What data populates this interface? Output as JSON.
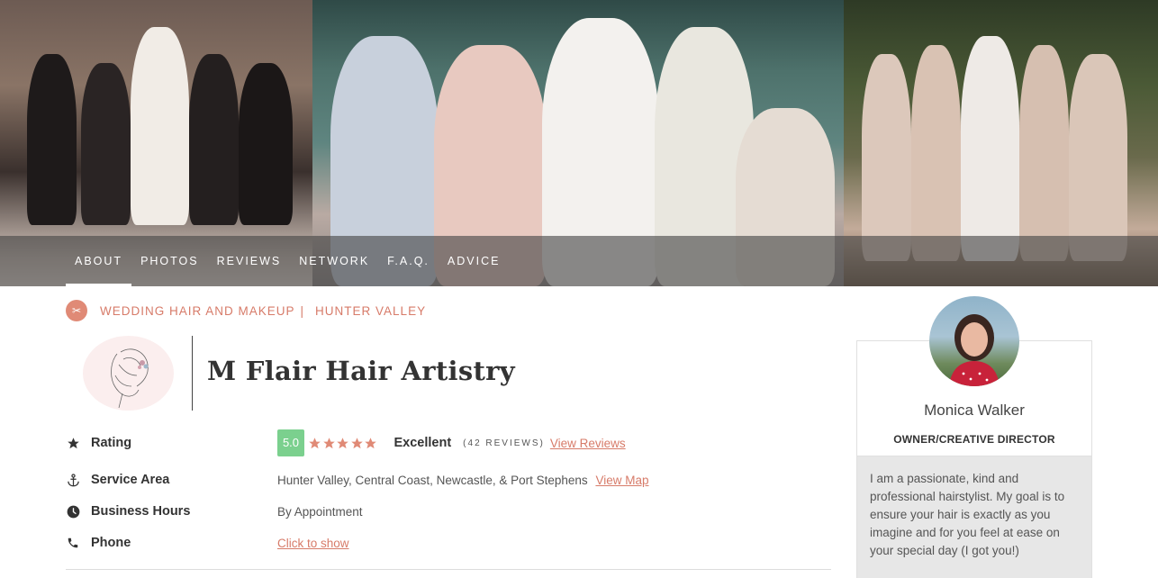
{
  "nav": {
    "items": [
      {
        "label": "ABOUT",
        "active": true
      },
      {
        "label": "PHOTOS",
        "active": false
      },
      {
        "label": "REVIEWS",
        "active": false
      },
      {
        "label": "NETWORK",
        "active": false
      },
      {
        "label": "F.A.Q.",
        "active": false
      },
      {
        "label": "ADVICE",
        "active": false
      }
    ]
  },
  "breadcrumb": {
    "icon": "scissors-icon",
    "category": "WEDDING HAIR AND MAKEUP",
    "separator": "|",
    "location": "HUNTER VALLEY"
  },
  "vendor": {
    "name": "M Flair Hair Artistry"
  },
  "details": {
    "rating": {
      "label": "Rating",
      "icon": "star-icon",
      "score": "5.0",
      "stars": 5,
      "summary": "Excellent",
      "count_text": "(42 REVIEWS)",
      "link": "View Reviews"
    },
    "service_area": {
      "label": "Service Area",
      "icon": "anchor-icon",
      "value": "Hunter Valley, Central Coast, Newcastle, & Port Stephens",
      "link": "View Map"
    },
    "hours": {
      "label": "Business Hours",
      "icon": "clock-icon",
      "value": "By Appointment"
    },
    "phone": {
      "label": "Phone",
      "icon": "phone-icon",
      "link": "Click to show"
    }
  },
  "profile": {
    "name": "Monica Walker",
    "title": "OWNER/CREATIVE DIRECTOR",
    "bio": "I am a passionate, kind and professional hairstylist. My goal is to ensure your hair is exactly as you imagine and for you feel at ease on your special day (I got you!)"
  },
  "colors": {
    "accent": "#d77b69",
    "star": "#e08a76",
    "score_badge": "#7bd08e",
    "bio_background": "#e7e7e7"
  }
}
